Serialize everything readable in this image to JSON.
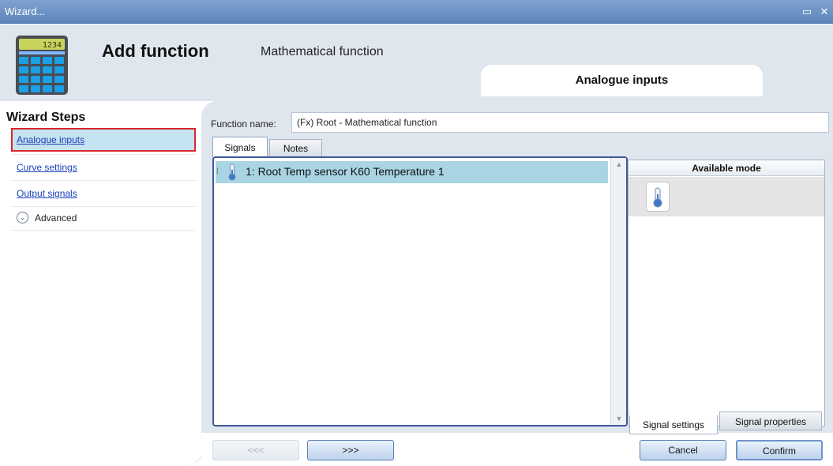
{
  "window": {
    "title": "Wizard...",
    "maximize_icon": "maximize-icon",
    "close_icon": "close-icon"
  },
  "header": {
    "title": "Add function",
    "subtitle": "Mathematical function",
    "current_step": "Analogue inputs",
    "calculator_display": "1234"
  },
  "sidebar": {
    "title": "Wizard Steps",
    "items": [
      {
        "label": "Analogue inputs",
        "active": true
      },
      {
        "label": "Curve settings",
        "active": false
      },
      {
        "label": "Output signals",
        "active": false
      }
    ],
    "advanced_label": "Advanced"
  },
  "form": {
    "function_name_label": "Function name:",
    "function_name_value": "(Fx) Root - Mathematical function"
  },
  "tabs": {
    "signals": "Signals",
    "notes": "Notes"
  },
  "signals_list": [
    {
      "label": "1: Root Temp sensor K60 Temperature 1",
      "icon": "thermometer-icon"
    }
  ],
  "mode_panel": {
    "header": "Available mode",
    "modes": [
      {
        "icon": "thermometer-icon"
      }
    ]
  },
  "bottom_tabs": {
    "settings": "Signal settings",
    "properties": "Signal properties"
  },
  "buttons": {
    "prev": "<<<",
    "next": ">>>",
    "cancel": "Cancel",
    "confirm": "Confirm"
  },
  "colors": {
    "accent": "#5d86bd",
    "active_item_border": "#d9262e",
    "selection": "#a9d4e4"
  }
}
